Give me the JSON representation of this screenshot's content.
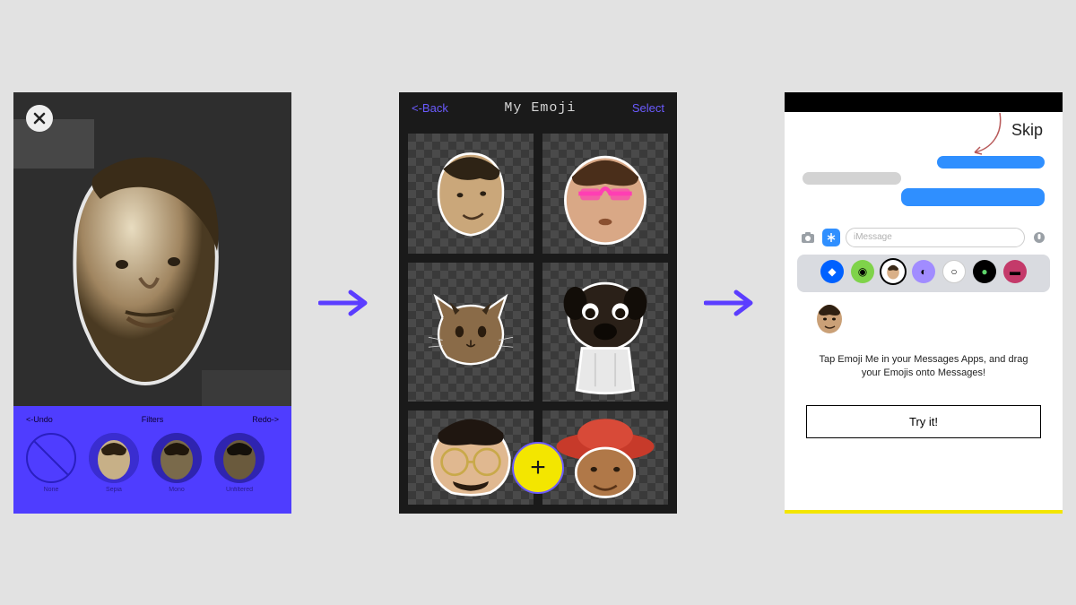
{
  "screen1": {
    "close_aria": "close",
    "bottom": {
      "undo": "<-Undo",
      "filters": "Filters",
      "redo": "Redo->",
      "thumb_labels": [
        "None",
        "Sepia",
        "Mono",
        "Unfiltered"
      ]
    }
  },
  "screen2": {
    "back": "<-Back",
    "title": "My Emoji",
    "select": "Select",
    "add_aria": "add"
  },
  "screen3": {
    "skip": "Skip",
    "input_placeholder": "iMessage",
    "hint": "Tap Emoji Me in your Messages Apps, and drag your Emojis onto Messages!",
    "try_button": "Try it!"
  },
  "colors": {
    "accent_purple": "#4f3dff",
    "accent_yellow": "#f3e600",
    "arrow": "#5b3dff"
  }
}
